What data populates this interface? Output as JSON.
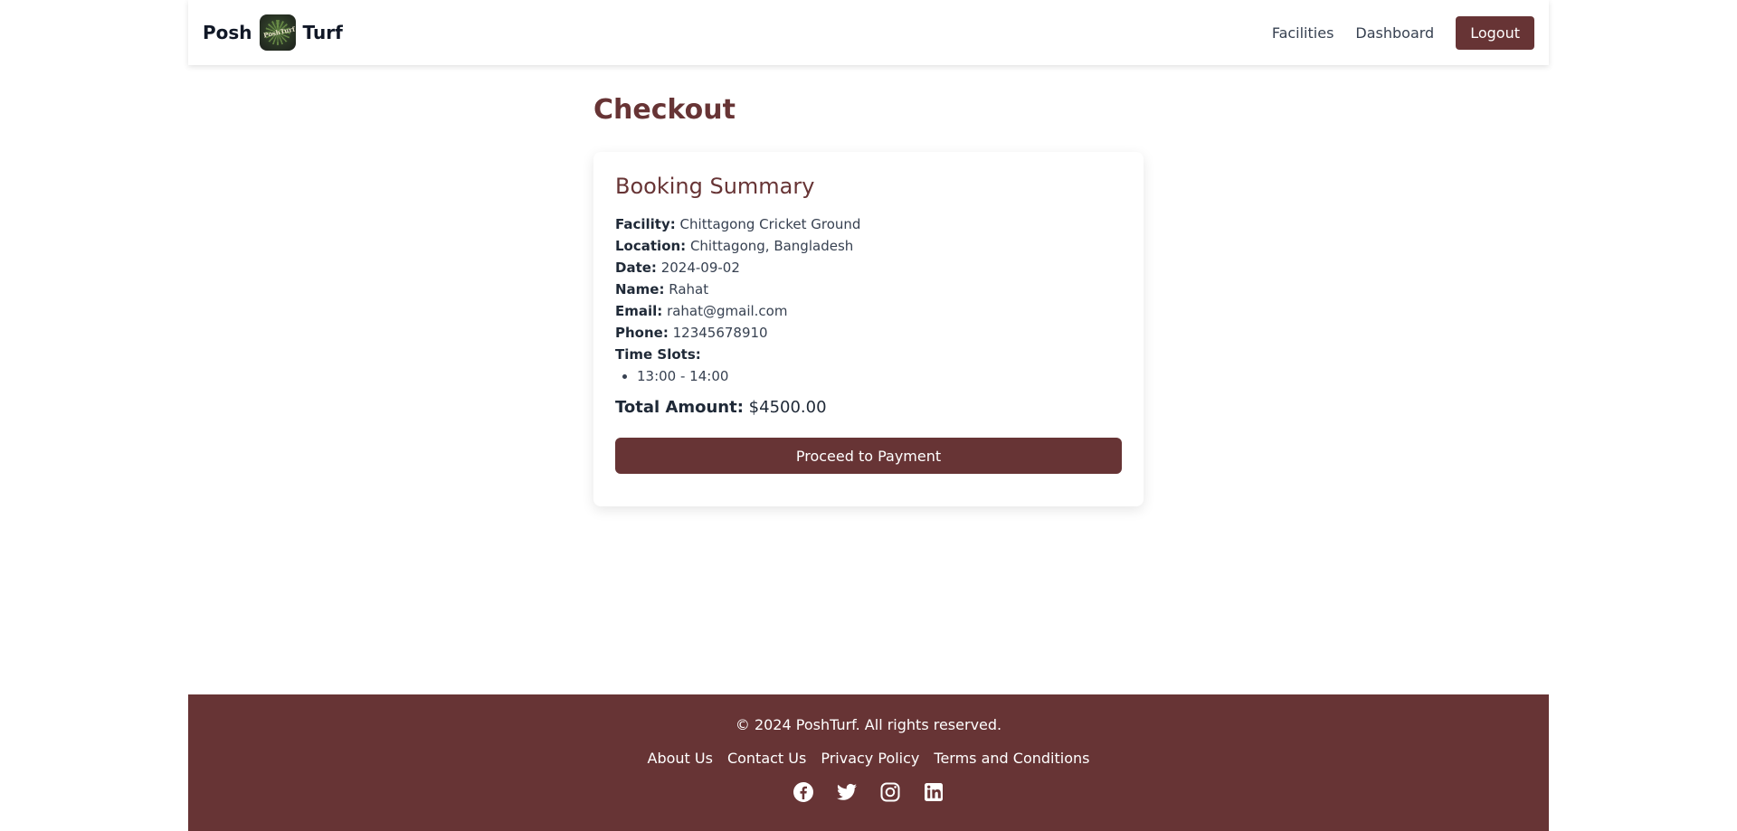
{
  "nav": {
    "brand_left": "Posh",
    "brand_right": "Turf",
    "logo_text": "PoshTurf",
    "links": [
      "Facilities",
      "Dashboard"
    ],
    "logout_label": "Logout"
  },
  "page": {
    "title": "Checkout"
  },
  "summary": {
    "title": "Booking Summary",
    "facility_label": "Facility:",
    "facility": "Chittagong Cricket Ground",
    "location_label": "Location:",
    "location": "Chittagong, Bangladesh",
    "date_label": "Date:",
    "date": "2024-09-02",
    "name_label": "Name:",
    "name": "Rahat",
    "email_label": "Email:",
    "email": "rahat@gmail.com",
    "phone_label": "Phone:",
    "phone": "12345678910",
    "slots_label": "Time Slots:",
    "slots": [
      "13:00 - 14:00"
    ],
    "total_label": "Total Amount:",
    "total": "$4500.00",
    "pay_label": "Proceed to Payment"
  },
  "footer": {
    "copyright": "© 2024 PoshTurf. All rights reserved.",
    "links": [
      "About Us",
      "Contact Us",
      "Privacy Policy",
      "Terms and Conditions"
    ],
    "socials": [
      "facebook-icon",
      "twitter-icon",
      "instagram-icon",
      "linkedin-icon"
    ]
  },
  "colors": {
    "brand": "#673435",
    "text": "#374151",
    "background": "#ffffff"
  }
}
